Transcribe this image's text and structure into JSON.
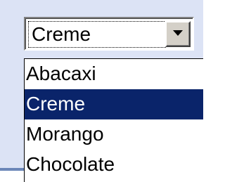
{
  "select": {
    "value": "Creme",
    "button_icon": "chevron-down-icon"
  },
  "options": [
    {
      "label": "Abacaxi",
      "selected": false
    },
    {
      "label": "Creme",
      "selected": true
    },
    {
      "label": "Morango",
      "selected": false
    },
    {
      "label": "Chocolate",
      "selected": false
    }
  ],
  "colors": {
    "panel_background": "#dce3f5",
    "bottom_rule": "#6b86b8",
    "selection_background": "#0a246a",
    "selection_text": "#ffffff",
    "button_face": "#d4d0c8"
  }
}
